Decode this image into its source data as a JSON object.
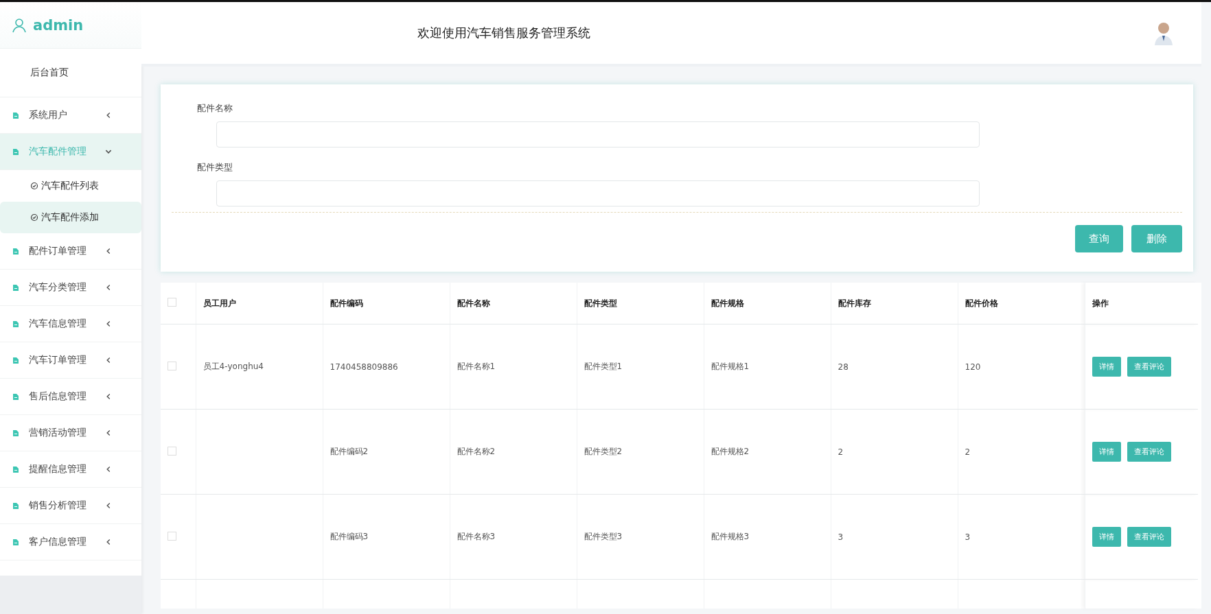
{
  "sidebar": {
    "user": "admin",
    "home": "后台首页",
    "items": [
      {
        "label": "系统用户",
        "expanded": false,
        "selected": false
      },
      {
        "label": "汽车配件管理",
        "expanded": true,
        "selected": true,
        "children": [
          {
            "label": "汽车配件列表",
            "selected": false
          },
          {
            "label": "汽车配件添加",
            "selected": true
          }
        ]
      },
      {
        "label": "配件订单管理",
        "expanded": false,
        "selected": false
      },
      {
        "label": "汽车分类管理",
        "expanded": false,
        "selected": false
      },
      {
        "label": "汽车信息管理",
        "expanded": false,
        "selected": false
      },
      {
        "label": "汽车订单管理",
        "expanded": false,
        "selected": false
      },
      {
        "label": "售后信息管理",
        "expanded": false,
        "selected": false
      },
      {
        "label": "营销活动管理",
        "expanded": false,
        "selected": false
      },
      {
        "label": "提醒信息管理",
        "expanded": false,
        "selected": false
      },
      {
        "label": "销售分析管理",
        "expanded": false,
        "selected": false
      },
      {
        "label": "客户信息管理",
        "expanded": false,
        "selected": false
      }
    ]
  },
  "header": {
    "title": "欢迎使用汽车销售服务管理系统"
  },
  "search": {
    "fields": [
      {
        "label": "配件名称"
      },
      {
        "label": "配件类型"
      }
    ],
    "buttons": [
      "查询",
      "删除"
    ]
  },
  "table": {
    "columns": [
      "员工用户",
      "配件编码",
      "配件名称",
      "配件类型",
      "配件规格",
      "配件库存",
      "配件价格",
      "操作"
    ],
    "select_all": {
      "checked": false
    },
    "rows": [
      {
        "checked": false,
        "cells": [
          "员工4-yonghu4",
          "1740458809886",
          "配件名称1",
          "配件类型1",
          "配件规格1",
          "28",
          "120"
        ],
        "actions": [
          "详情",
          "查看评论"
        ]
      },
      {
        "checked": false,
        "cells": [
          "",
          "配件编码2",
          "配件名称2",
          "配件类型2",
          "配件规格2",
          "2",
          "2"
        ],
        "actions": [
          "详情",
          "查看评论"
        ]
      },
      {
        "checked": false,
        "cells": [
          "",
          "配件编码3",
          "配件名称3",
          "配件类型3",
          "配件规格3",
          "3",
          "3"
        ],
        "actions": [
          "详情",
          "查看评论"
        ]
      }
    ]
  }
}
